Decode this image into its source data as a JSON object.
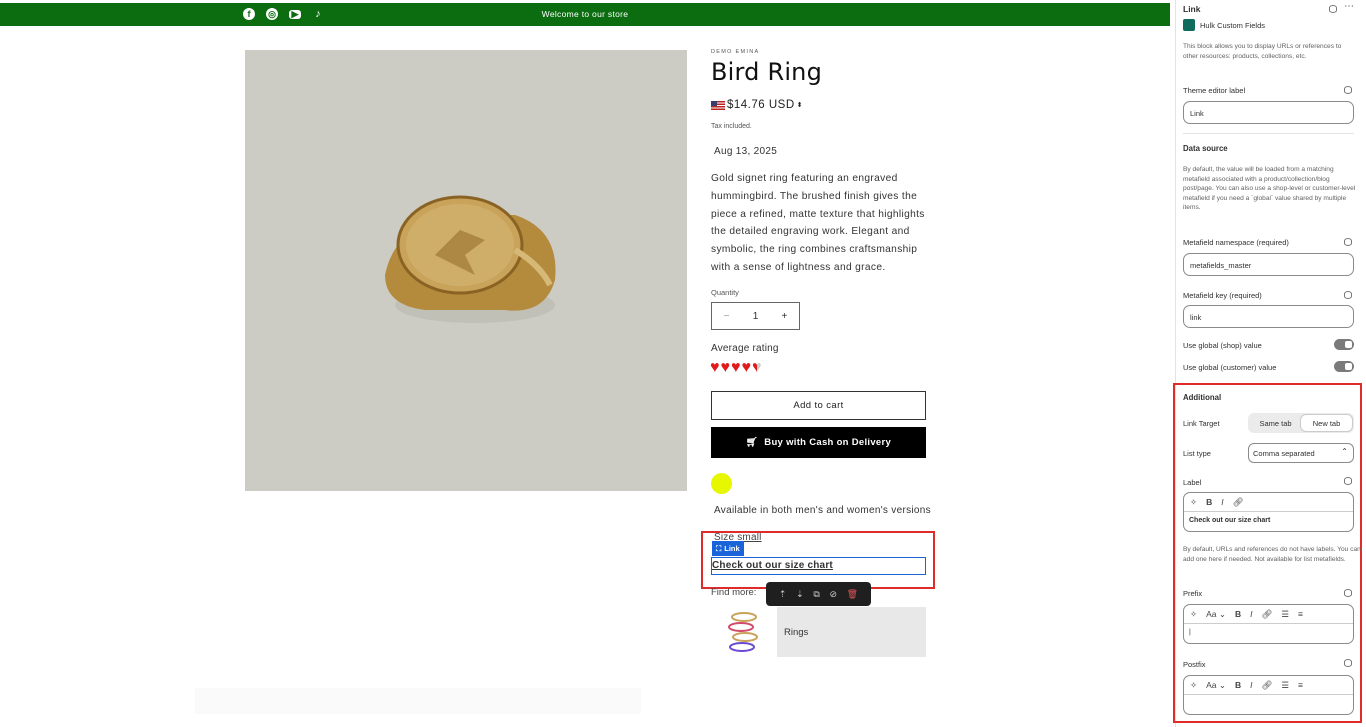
{
  "announcement": {
    "text": "Welcome to our store",
    "bg": "#0b6c10",
    "social_icons": [
      "facebook-icon",
      "instagram-icon",
      "youtube-icon",
      "tiktok-icon"
    ]
  },
  "product": {
    "vendor": "DEMO EMINA",
    "title": "Bird Ring",
    "price": "$14.76 USD",
    "tax_note": "Tax included.",
    "date": "Aug 13, 2025",
    "description": "Gold signet ring featuring an engraved hummingbird. The brushed finish gives the piece a refined, matte texture that highlights the detailed engraving work. Elegant and symbolic, the ring combines craftsmanship with a sense of lightness and grace.",
    "quantity_label": "Quantity",
    "quantity_value": "1",
    "rating_label": "Average rating",
    "rating_value": 4.5,
    "rating_max": 5,
    "add_to_cart": "Add to cart",
    "buy_cod": "Buy with Cash on Delivery",
    "availability": "Available in both men's and women's versions",
    "size_text": "Size small",
    "link_tag": "Link",
    "link_text": "Check out our size chart",
    "find_more": "Find more:",
    "collection_card": "Rings"
  },
  "panel": {
    "title": "Link",
    "app_name": "Hulk Custom Fields",
    "intro": "This block allows you to display URLs or references to other resources: products, collections, etc.",
    "theme_label_title": "Theme editor label",
    "theme_label_value": "Link",
    "data_source_title": "Data source",
    "data_source_desc": "By default, the value will be loaded from a matching metafield associated with a product/collection/blog post/page. You can also use a shop-level or customer-level metafield if you need a `global` value shared by multiple items.",
    "namespace_label": "Metafield namespace (required)",
    "namespace_value": "metafields_master",
    "key_label": "Metafield key (required)",
    "key_value": "link",
    "global_shop": "Use global (shop) value",
    "global_customer": "Use global (customer) value",
    "additional_title": "Additional",
    "link_target_label": "Link Target",
    "link_target_options": [
      "Same tab",
      "New tab"
    ],
    "link_target_selected": "New tab",
    "list_type_label": "List type",
    "list_type_value": "Comma separated",
    "label_label": "Label",
    "label_value": "Check out our size chart",
    "label_help": "By default, URLs and references do not have labels. You can add one here if needed. Not available for list metafields.",
    "prefix_label": "Prefix",
    "postfix_label": "Postfix",
    "font_toggle": "Aa"
  },
  "colors": {
    "highlight_red": "#e12a2a",
    "editor_blue": "#1a63d9",
    "swatch_yellow": "#e6f700",
    "heart_red": "#e01b1b"
  }
}
